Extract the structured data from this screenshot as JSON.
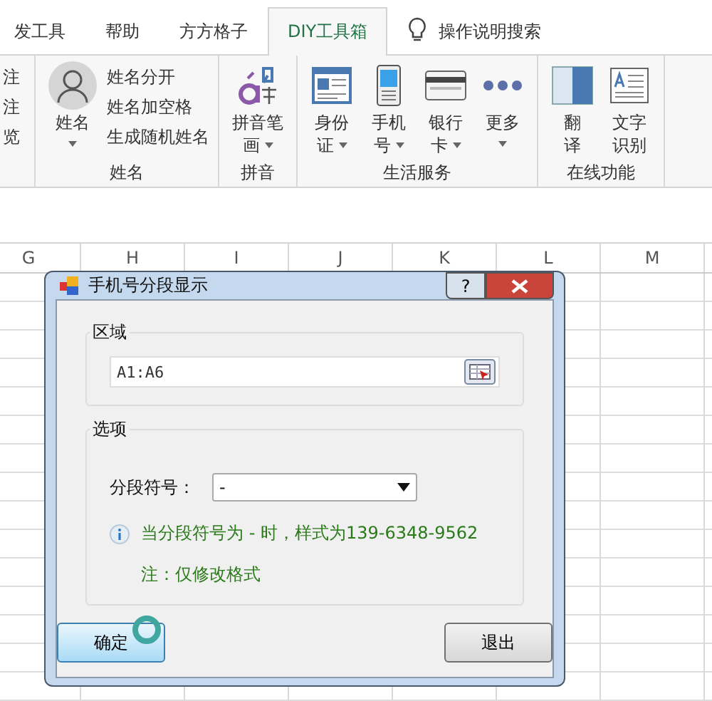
{
  "tabs": [
    {
      "label": "发工具",
      "selected": false
    },
    {
      "label": "帮助",
      "selected": false
    },
    {
      "label": "方方格子",
      "selected": false
    },
    {
      "label": "DIY工具箱",
      "selected": true
    }
  ],
  "tell_me": "操作说明搜索",
  "partial_group": {
    "items": [
      "注",
      "注",
      "览"
    ]
  },
  "groups": [
    {
      "name": "姓名",
      "buttons": [
        {
          "kind": "person",
          "lines": [
            "姓名"
          ],
          "dropdown": true
        }
      ],
      "small_items": [
        "姓名分开",
        "姓名加空格",
        "生成随机姓名"
      ]
    },
    {
      "name": "拼音",
      "buttons": [
        {
          "kind": "pinyin",
          "lines": [
            "拼音笔",
            "画"
          ],
          "dropdown": true
        }
      ]
    },
    {
      "name": "生活服务",
      "buttons": [
        {
          "kind": "idcard",
          "lines": [
            "身份",
            "证"
          ],
          "dropdown": true
        },
        {
          "kind": "phone",
          "lines": [
            "手机",
            "号"
          ],
          "dropdown": true
        },
        {
          "kind": "bankcard",
          "lines": [
            "银行",
            "卡"
          ],
          "dropdown": true
        },
        {
          "kind": "more",
          "lines": [
            "更多"
          ],
          "dropdown": true
        }
      ]
    },
    {
      "name": "在线功能",
      "buttons": [
        {
          "kind": "translate",
          "lines": [
            "翻",
            "译"
          ],
          "dropdown": false
        },
        {
          "kind": "ocr",
          "lines": [
            "文字",
            "识别"
          ],
          "dropdown": false
        }
      ]
    }
  ],
  "columns": [
    "G",
    "H",
    "I",
    "J",
    "K",
    "L",
    "M"
  ],
  "dialog": {
    "title": "手机号分段显示",
    "help": "?",
    "region": {
      "legend": "区域",
      "value": "A1:A6"
    },
    "options": {
      "legend": "选项",
      "label": "分段符号：",
      "value": "-",
      "info": "当分段符号为 - 时，样式为139-6348-9562",
      "note": "注：仅修改格式"
    },
    "buttons": [
      {
        "label": "确定",
        "focused": true
      },
      {
        "label": "退出",
        "focused": false
      }
    ]
  }
}
